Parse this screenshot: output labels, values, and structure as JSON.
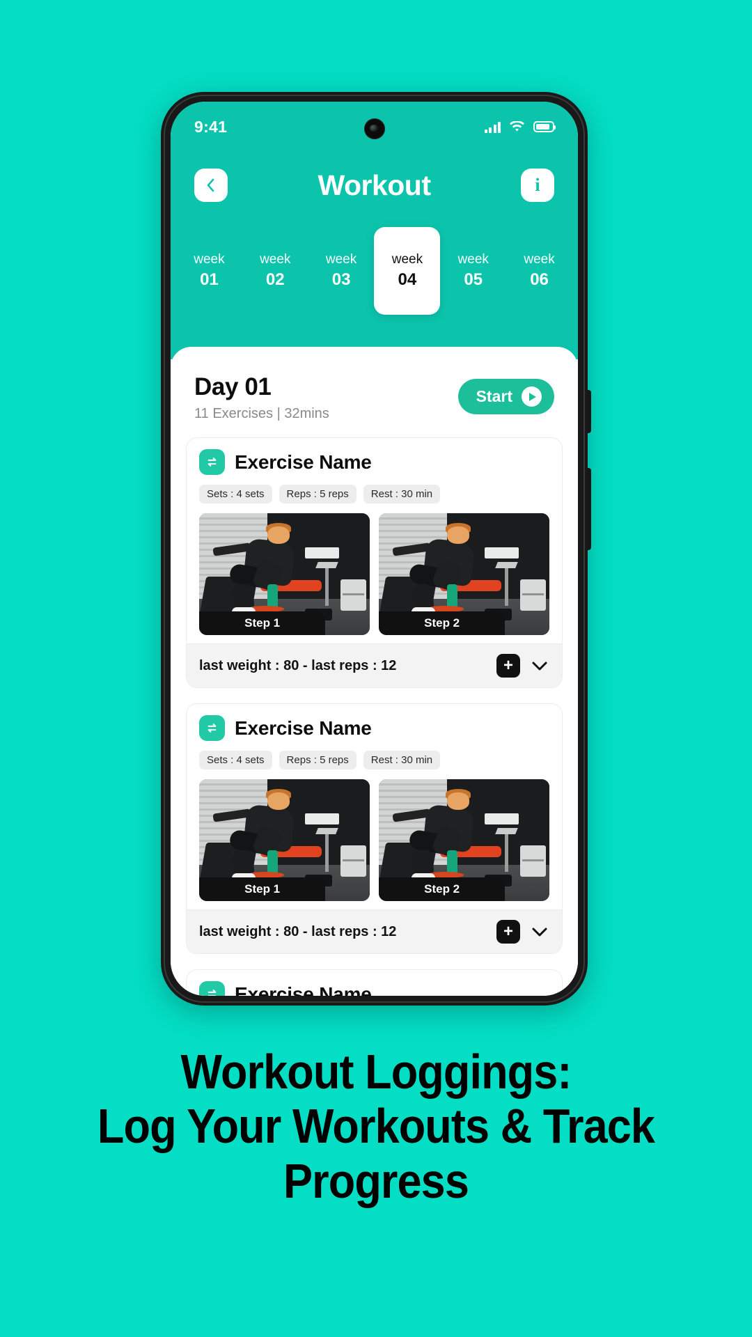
{
  "theme": {
    "background": "#04DEC4",
    "header_green": "#0CC4AC",
    "accent_green": "#1DBF9B",
    "icon_green": "#22C9A7",
    "dark": "#111111"
  },
  "statusbar": {
    "time": "9:41",
    "signal_icon": "cellular-signal-icon",
    "wifi_icon": "wifi-icon",
    "battery_icon": "battery-icon"
  },
  "header": {
    "back_icon": "chevron-left-icon",
    "title": "Workout",
    "info_label": "i",
    "info_icon": "info-icon"
  },
  "weeks": {
    "selected_index": 3,
    "items": [
      {
        "label": "week",
        "number": "01"
      },
      {
        "label": "week",
        "number": "02"
      },
      {
        "label": "week",
        "number": "03"
      },
      {
        "label": "week",
        "number": "04"
      },
      {
        "label": "week",
        "number": "05"
      },
      {
        "label": "week",
        "number": "06"
      }
    ]
  },
  "day": {
    "title": "Day 01",
    "subtitle": "11 Exercises | 32mins",
    "start_label": "Start",
    "play_icon": "play-icon"
  },
  "exercises": [
    {
      "icon": "swap-arrows-icon",
      "name": "Exercise Name",
      "chips": [
        "Sets : 4 sets",
        "Reps : 5 reps",
        "Rest : 30 min"
      ],
      "steps": [
        {
          "label": "Step 1",
          "image": "gym-athlete-photo"
        },
        {
          "label": "Step 2",
          "image": "gym-athlete-photo"
        }
      ],
      "footer": {
        "text": "last weight : 80 - last reps : 12",
        "add_label": "+",
        "add_icon": "plus-icon",
        "expand_icon": "chevron-down-icon"
      }
    },
    {
      "icon": "swap-arrows-icon",
      "name": "Exercise Name",
      "chips": [
        "Sets : 4 sets",
        "Reps : 5 reps",
        "Rest : 30 min"
      ],
      "steps": [
        {
          "label": "Step 1",
          "image": "gym-athlete-photo"
        },
        {
          "label": "Step 2",
          "image": "gym-athlete-photo"
        }
      ],
      "footer": {
        "text": "last weight : 80 - last reps : 12",
        "add_label": "+",
        "add_icon": "plus-icon",
        "expand_icon": "chevron-down-icon"
      }
    }
  ],
  "caption": {
    "line1": "Workout Loggings:",
    "line2": "Log Your Workouts & Track",
    "line3": "Progress"
  }
}
